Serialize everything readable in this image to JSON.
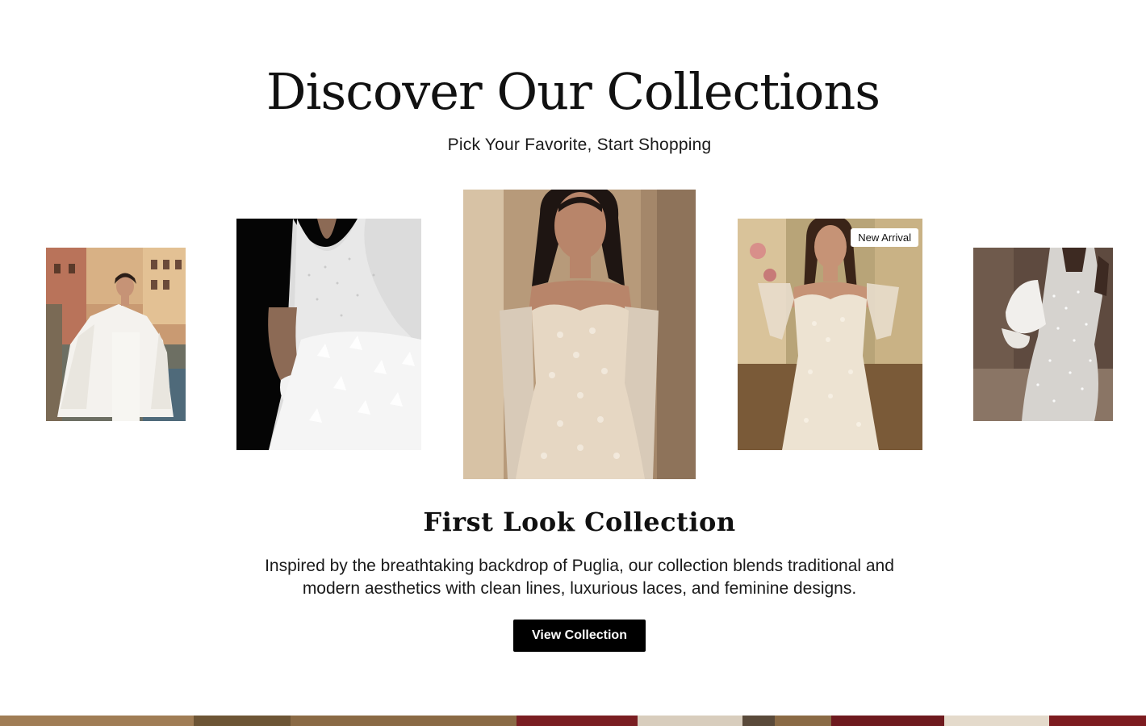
{
  "header": {
    "title": "Discover Our Collections",
    "subtitle": "Pick Your Favorite, Start Shopping"
  },
  "carousel": {
    "items": [
      {
        "alt": "Bride in feathered cape on harbor terrace"
      },
      {
        "alt": "Close-up of beaded bodice and feathered skirt"
      },
      {
        "alt": "Strapless lace mermaid gown with lace gloves"
      },
      {
        "alt": "Strapless lace gown with sheer lace sleeves",
        "badge": "New Arrival"
      },
      {
        "alt": "Pearl-embellished gown with puff sleeves"
      }
    ]
  },
  "collection": {
    "title": "First Look Collection",
    "description": "Inspired by the breathtaking backdrop of Puglia, our collection blends traditional and modern aesthetics with clean lines, luxurious laces, and feminine designs.",
    "button_label": "View Collection"
  },
  "colors": {
    "background": "#ffffff",
    "text": "#111111",
    "button_bg": "#000000",
    "button_text": "#ffffff"
  }
}
